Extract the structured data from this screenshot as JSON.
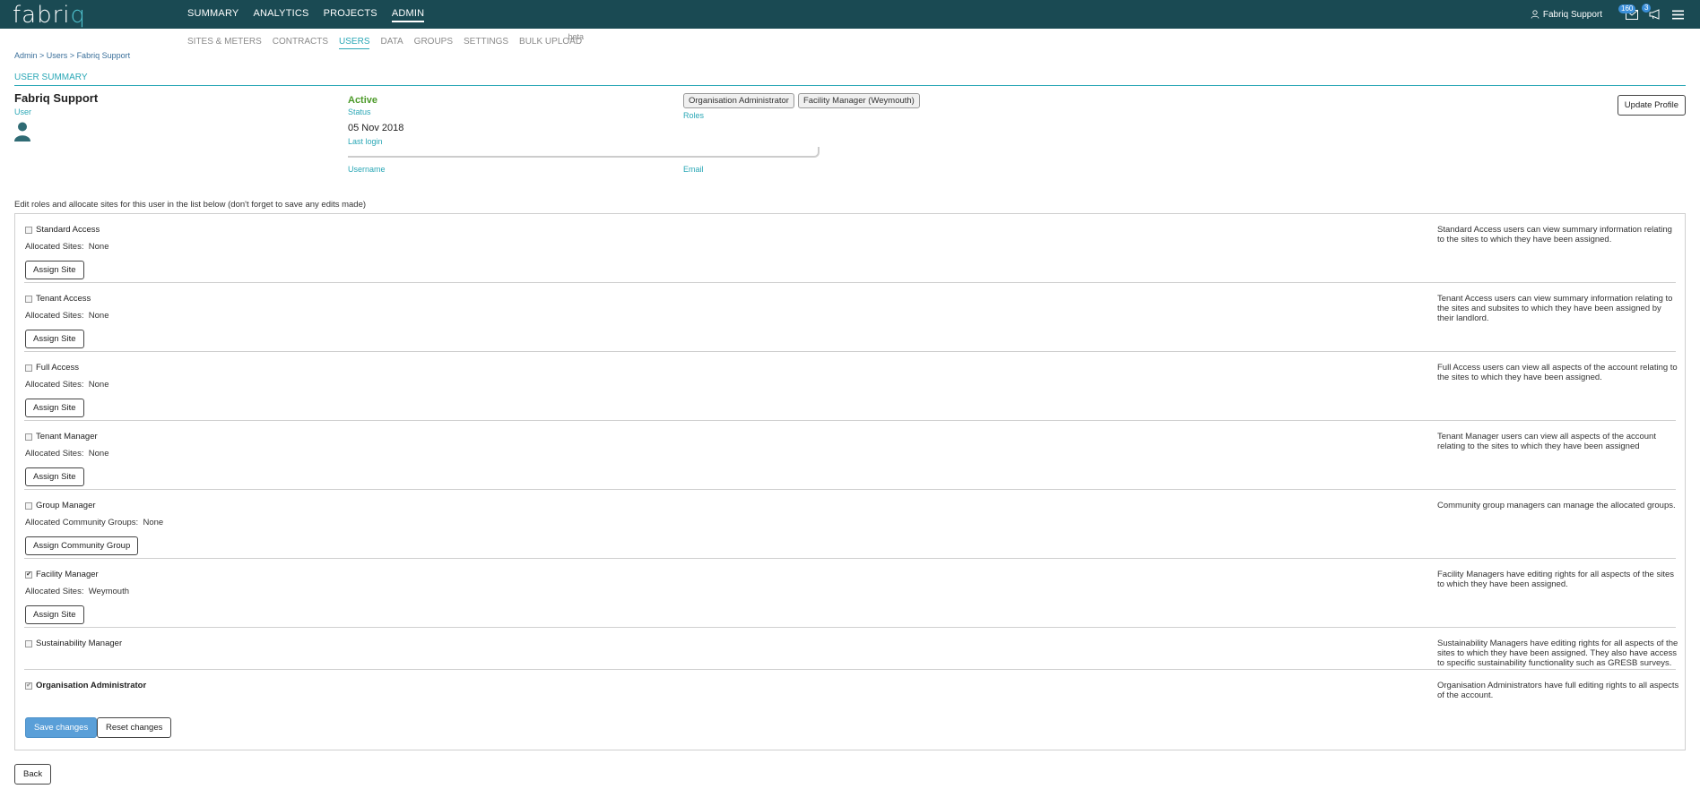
{
  "brand": {
    "logo_main": "fabri",
    "logo_accent": "q"
  },
  "main_nav": [
    {
      "label": "SUMMARY"
    },
    {
      "label": "ANALYTICS"
    },
    {
      "label": "PROJECTS"
    },
    {
      "label": "ADMIN",
      "active": true
    }
  ],
  "top_right": {
    "user_name": "Fabriq Support",
    "mail_badge": "160",
    "notif_badge": "3"
  },
  "sub_nav": [
    {
      "label": "SITES & METERS"
    },
    {
      "label": "CONTRACTS"
    },
    {
      "label": "USERS",
      "active": true
    },
    {
      "label": "DATA"
    },
    {
      "label": "GROUPS"
    },
    {
      "label": "SETTINGS"
    },
    {
      "label": "BULK UPLOAD",
      "beta": "beta"
    }
  ],
  "breadcrumb": {
    "admin": "Admin",
    "users": "Users",
    "current": "Fabriq Support",
    "sep": " > "
  },
  "section_title": "USER SUMMARY",
  "profile": {
    "name": "Fabriq Support",
    "name_label": "User",
    "status": "Active",
    "status_label": "Status",
    "last_login": "05 Nov 2018",
    "last_login_label": "Last login",
    "username_label": "Username",
    "email_label": "Email",
    "roles": [
      "Organisation Administrator",
      "Facility Manager (Weymouth)"
    ],
    "roles_label": "Roles",
    "update_btn": "Update Profile"
  },
  "intro": "Edit roles and allocate sites for this user in the list below (don't forget to save any edits made)",
  "roles": [
    {
      "name": "Standard Access",
      "checked": false,
      "alloc_label": "Allocated Sites:",
      "alloc_value": "None",
      "btn": "Assign Site",
      "desc": "Standard Access users can view summary information relating to the sites to which they have been assigned."
    },
    {
      "name": "Tenant Access",
      "checked": false,
      "alloc_label": "Allocated Sites:",
      "alloc_value": "None",
      "btn": "Assign Site",
      "desc": "Tenant Access users can view summary information relating to the sites and subsites to which they have been assigned by their landlord."
    },
    {
      "name": "Full Access",
      "checked": false,
      "alloc_label": "Allocated Sites:",
      "alloc_value": "None",
      "btn": "Assign Site",
      "desc": "Full Access users can view all aspects of the account relating to the sites to which they have been assigned."
    },
    {
      "name": "Tenant Manager",
      "checked": false,
      "alloc_label": "Allocated Sites:",
      "alloc_value": "None",
      "btn": "Assign Site",
      "desc": "Tenant Manager users can view all aspects of the account relating to the sites to which they have been assigned"
    },
    {
      "name": "Group Manager",
      "checked": false,
      "alloc_label": "Allocated Community Groups:",
      "alloc_value": "None",
      "btn": "Assign Community Group",
      "desc": "Community group managers can manage the allocated groups."
    },
    {
      "name": "Facility Manager",
      "checked": true,
      "alloc_label": "Allocated Sites:",
      "alloc_value": "Weymouth",
      "btn": "Assign Site",
      "desc": "Facility Managers have editing rights for all aspects of the sites to which they have been assigned."
    },
    {
      "name": "Sustainability Manager",
      "checked": false,
      "desc": "Sustainability Managers have editing rights for all aspects of the sites to which they have been assigned. They also have access to specific sustainability functionality such as GRESB surveys."
    },
    {
      "name": "Organisation Administrator",
      "checked": true,
      "bold": true,
      "desc": "Organisation Administrators have full editing rights to all aspects of the account."
    }
  ],
  "actions": {
    "save": "Save changes",
    "reset": "Reset changes",
    "back": "Back"
  },
  "colors": {
    "topbar": "#1a4a53",
    "accent": "#2aa7b6",
    "active_status": "#4d9a2a",
    "primary_btn": "#5a9fd8"
  }
}
